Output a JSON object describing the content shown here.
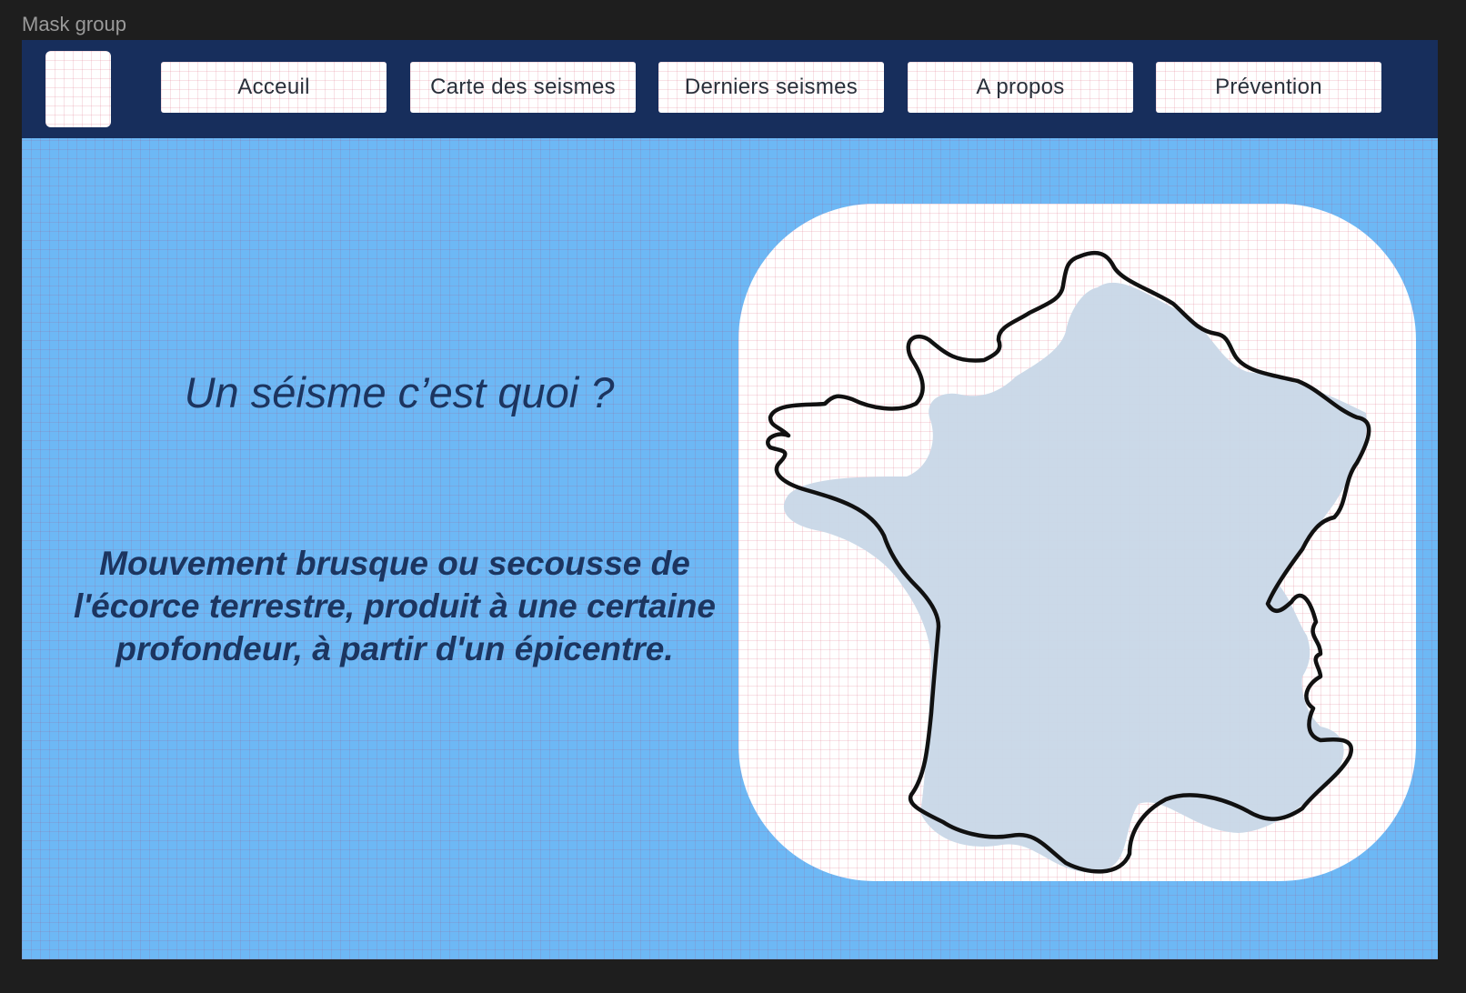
{
  "frame": {
    "label": "Mask group"
  },
  "nav": {
    "logo_icon": "logo-placeholder",
    "items": [
      {
        "label": "Acceuil"
      },
      {
        "label": "Carte des seismes"
      },
      {
        "label": "Derniers seismes"
      },
      {
        "label": "A propos"
      },
      {
        "label": "Prévention"
      }
    ]
  },
  "hero": {
    "title": "Un séisme c’est quoi ?",
    "definition": "Mouvement brusque ou secousse de l'écorce terrestre, produit à une certaine profondeur, à partir d'un épicentre."
  },
  "illustration": {
    "icon": "france-map-icon",
    "fill_color": "#c8d7e7",
    "stroke_color": "#111111"
  },
  "colors": {
    "background": "#1e1e1e",
    "navbar": "#172e5c",
    "content": "#6db8f5",
    "text": "#1c3560"
  }
}
